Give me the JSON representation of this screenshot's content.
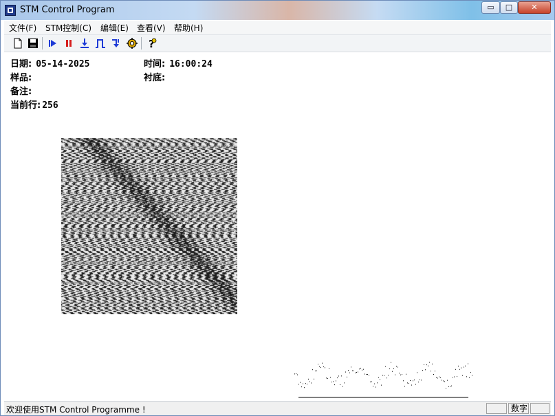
{
  "window": {
    "title": "STM Control Program",
    "controls": {
      "minimize": "▭",
      "maximize": "□",
      "close": "✕"
    }
  },
  "menu": [
    "文件(F)",
    "STM控制(C)",
    "编辑(E)",
    "查看(V)",
    "帮助(H)"
  ],
  "toolbar": {
    "icons": [
      "new-file-icon",
      "save-icon",
      "run-icon",
      "pause-icon",
      "approach-icon",
      "pulse-icon",
      "retract-icon",
      "settings-gear-icon",
      "help-icon"
    ]
  },
  "info": {
    "date_label": "日期:",
    "date_value": "05-14-2025",
    "time_label": "时间:",
    "time_value": "16:00:24",
    "sample_label": "样品:",
    "sample_value": "",
    "substrate_label": "衬底:",
    "substrate_value": "",
    "note_label": "备注:",
    "note_value": "",
    "current_line_label": "当前行:",
    "current_line_value": "256"
  },
  "status": {
    "message": "欢迎使用STM Control Programme !",
    "pane_numeric": "数字"
  },
  "colors": {
    "accent_blue": "#1e3bd6",
    "pause_red": "#d61e1e"
  }
}
